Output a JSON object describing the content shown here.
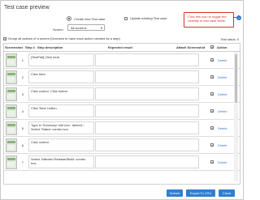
{
  "dialog": {
    "title": "Test case preview"
  },
  "mode": {
    "options": [
      {
        "label": "Create new Test case",
        "selected": true
      },
      {
        "label": "Update existing Test case",
        "selected": false
      }
    ]
  },
  "screen": {
    "label": "Screen",
    "selected_value": "All screens"
  },
  "callout": {
    "text": "Click this icon to toggle the visibility of test case fields.",
    "toggle_icon": "chevron-down-icon",
    "accent_color": "#d9302f"
  },
  "grouping": {
    "label": "Group all actions of a screen (Uncheck to have each action created as a step)",
    "checked": true
  },
  "test_steps": {
    "label": "Test steps: 0"
  },
  "table": {
    "headers": [
      "Screenshot",
      "Step #",
      "Step description",
      "Expected result",
      "Attach Screenshot",
      "Action"
    ],
    "select_all_checked": true,
    "rows": [
      {
        "step": "1",
        "description": "[TestFlat] Click here.",
        "expected": "",
        "attach": true,
        "action": "Delete"
      },
      {
        "step": "2",
        "description": "Click here.",
        "expected": "",
        "attach": true,
        "action": "Delete"
      },
      {
        "step": "3",
        "description": "Click control. Click button.",
        "expected": "",
        "attach": true,
        "action": "Delete"
      },
      {
        "step": "4",
        "description": "Click 'New' button.",
        "expected": "",
        "attach": true,
        "action": "Delete"
      },
      {
        "step": "5",
        "description": "Type in 'Summary' edit box: 'defect1'; Select 'Status' combo box.",
        "expected": "",
        "attach": true,
        "action": "Delete"
      },
      {
        "step": "6",
        "description": "Click control.",
        "expected": "",
        "attach": true,
        "action": "Delete"
      },
      {
        "step": "7",
        "description": "Select 'Affected Release/Build' combo box.",
        "expected": "",
        "attach": true,
        "action": "Delete"
      }
    ]
  },
  "footer": {
    "submit": "Submit",
    "export": "Export To CSV",
    "close": "Close",
    "button_color": "#2f7fd0"
  }
}
